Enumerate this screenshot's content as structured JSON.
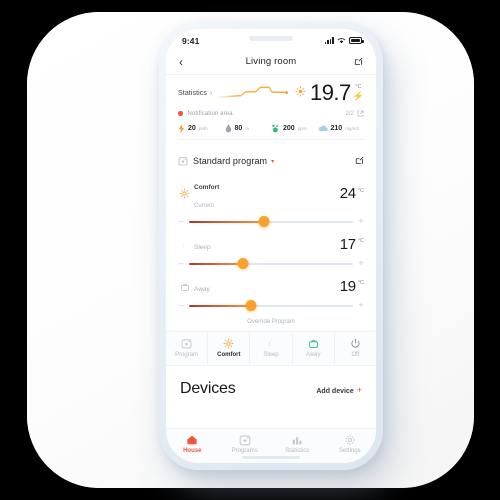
{
  "status_bar": {
    "time": "9:41",
    "signal_icon": "signal-bars-icon",
    "wifi_icon": "wifi-icon",
    "battery_icon": "battery-icon"
  },
  "app_bar": {
    "back_icon": "chevron-left-icon",
    "title": "Living room",
    "edit_icon": "edit-square-icon"
  },
  "statistics": {
    "label": "Statistics",
    "chevron": "›",
    "sun_icon": "sun-icon",
    "temperature": "19.7",
    "unit": "°C",
    "bolt_icon": "lightning-bolt-icon",
    "sparkline_color": "#f6a83c"
  },
  "notification": {
    "dot_color": "#f0563a",
    "text": "Notification area.",
    "count": "2/2",
    "external_icon": "external-link-icon"
  },
  "metrics": [
    {
      "icon": "bolt-icon",
      "value": "20",
      "unit": "kWh",
      "color": "#f9a12e"
    },
    {
      "icon": "humidity-icon",
      "value": "80",
      "unit": "%",
      "color": "#9aa5b1"
    },
    {
      "icon": "co2-icon",
      "value": "200",
      "unit": "ppm",
      "color": "#2bbf7e"
    },
    {
      "icon": "cloud-icon",
      "value": "210",
      "unit": "mg/m3",
      "color": "#9ed4ec"
    }
  ],
  "program": {
    "calendar_icon": "calendar-icon",
    "name": "Standard program",
    "caret": "▾",
    "edit_icon": "edit-square-icon"
  },
  "temperature_rows": [
    {
      "icon": "sun-icon",
      "title": "Comfort",
      "subtitle": "Current",
      "value": "24",
      "unit": "°C",
      "fill_percent": 46,
      "minus": "–",
      "plus": "+"
    },
    {
      "icon": "moon-icon",
      "title": "Sleep",
      "subtitle": "",
      "value": "17",
      "unit": "°C",
      "fill_percent": 33,
      "minus": "–",
      "plus": "+"
    },
    {
      "icon": "bag-icon",
      "title": "Away",
      "subtitle": "",
      "value": "19",
      "unit": "°C",
      "fill_percent": 38,
      "minus": "–",
      "plus": "+"
    }
  ],
  "override_label": "Override Program",
  "modes": [
    {
      "icon": "calendar-icon",
      "label": "Program",
      "active": false
    },
    {
      "icon": "sun-icon",
      "label": "Comfort",
      "active": true
    },
    {
      "icon": "moon-icon",
      "label": "Sleep",
      "active": false
    },
    {
      "icon": "bag-icon",
      "label": "Away",
      "active": false
    },
    {
      "icon": "power-icon",
      "label": "Off",
      "active": false
    }
  ],
  "devices": {
    "title": "Devices",
    "add_label": "Add device",
    "add_plus": "+"
  },
  "bottom_nav": [
    {
      "icon": "house-icon",
      "label": "House",
      "active": true
    },
    {
      "icon": "calendar-icon",
      "label": "Programs",
      "active": false
    },
    {
      "icon": "bar-chart-icon",
      "label": "Statistics",
      "active": false
    },
    {
      "icon": "gear-icon",
      "label": "Settings",
      "active": false
    }
  ]
}
